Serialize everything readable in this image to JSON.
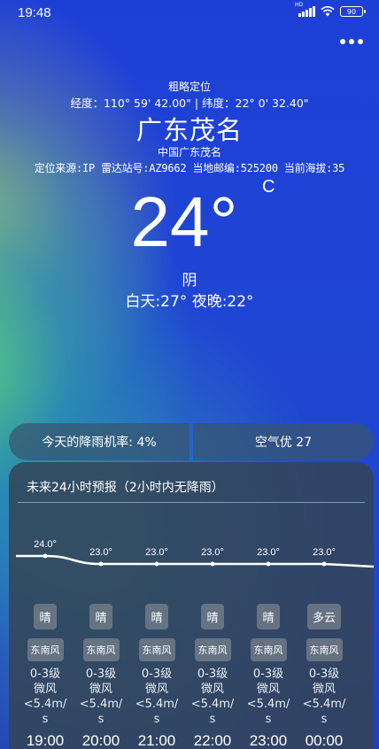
{
  "status_bar": {
    "time": "19:48",
    "network": "HD",
    "battery": "90"
  },
  "location": {
    "mode": "粗略定位",
    "coords": "经度：110° 59' 42.00\" | 纬度：22° 0' 32.40\"",
    "city": "广东茂名",
    "full_name": "中国广东茂名",
    "meta": "定位来源:IP 雷达站号:AZ9662 当地邮编:525200 当前海拔:35"
  },
  "weather": {
    "temperature": "24°",
    "unit": "C",
    "condition": "阴",
    "day_night": "白天:27° 夜晚:22°"
  },
  "summary": {
    "rain_chance": "今天的降雨机率: 4%",
    "air_quality": "空气优 27"
  },
  "forecast": {
    "title": "未来24小时预报（2小时内无降雨）",
    "hours": [
      {
        "temp_label": "24.0°",
        "temp": 24.0,
        "weather": "晴",
        "wind_dir": "东南风",
        "wind": [
          "0-3级",
          "微风",
          "<5.4m/",
          "s"
        ],
        "time": "19:00"
      },
      {
        "temp_label": "23.0°",
        "temp": 23.0,
        "weather": "晴",
        "wind_dir": "东南风",
        "wind": [
          "0-3级",
          "微风",
          "<5.4m/",
          "s"
        ],
        "time": "20:00"
      },
      {
        "temp_label": "23.0°",
        "temp": 23.0,
        "weather": "晴",
        "wind_dir": "东南风",
        "wind": [
          "0-3级",
          "微风",
          "<5.4m/",
          "s"
        ],
        "time": "21:00"
      },
      {
        "temp_label": "23.0°",
        "temp": 23.0,
        "weather": "晴",
        "wind_dir": "东南风",
        "wind": [
          "0-3级",
          "微风",
          "<5.4m/",
          "s"
        ],
        "time": "22:00"
      },
      {
        "temp_label": "23.0°",
        "temp": 23.0,
        "weather": "晴",
        "wind_dir": "东南风",
        "wind": [
          "0-3级",
          "微风",
          "<5.4m/",
          "s"
        ],
        "time": "23:00"
      },
      {
        "temp_label": "23.0°",
        "temp": 23.0,
        "weather": "多云",
        "wind_dir": "东南风",
        "wind": [
          "0-3级",
          "微风",
          "<5.4m/",
          "s"
        ],
        "time": "00:00"
      }
    ]
  }
}
